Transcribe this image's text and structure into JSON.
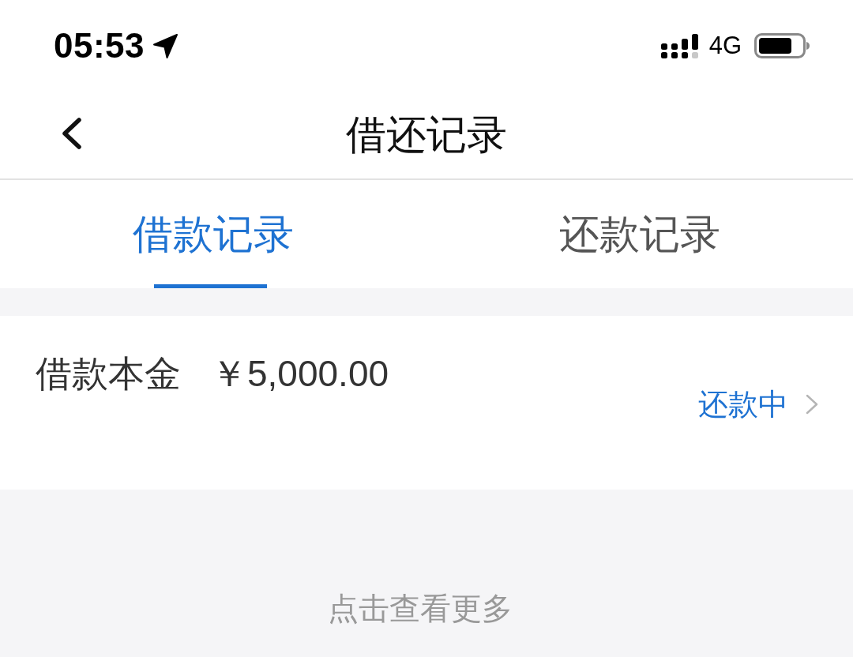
{
  "status_bar": {
    "time": "05:53",
    "network": "4G"
  },
  "nav_bar": {
    "title": "借还记录"
  },
  "tabs": [
    {
      "label": "借款记录",
      "selected": true
    },
    {
      "label": "还款记录",
      "selected": false
    }
  ],
  "records": [
    {
      "label": "借款本金",
      "amount": "￥5,000.00",
      "status": "还款中"
    }
  ],
  "load_more": "点击查看更多"
}
